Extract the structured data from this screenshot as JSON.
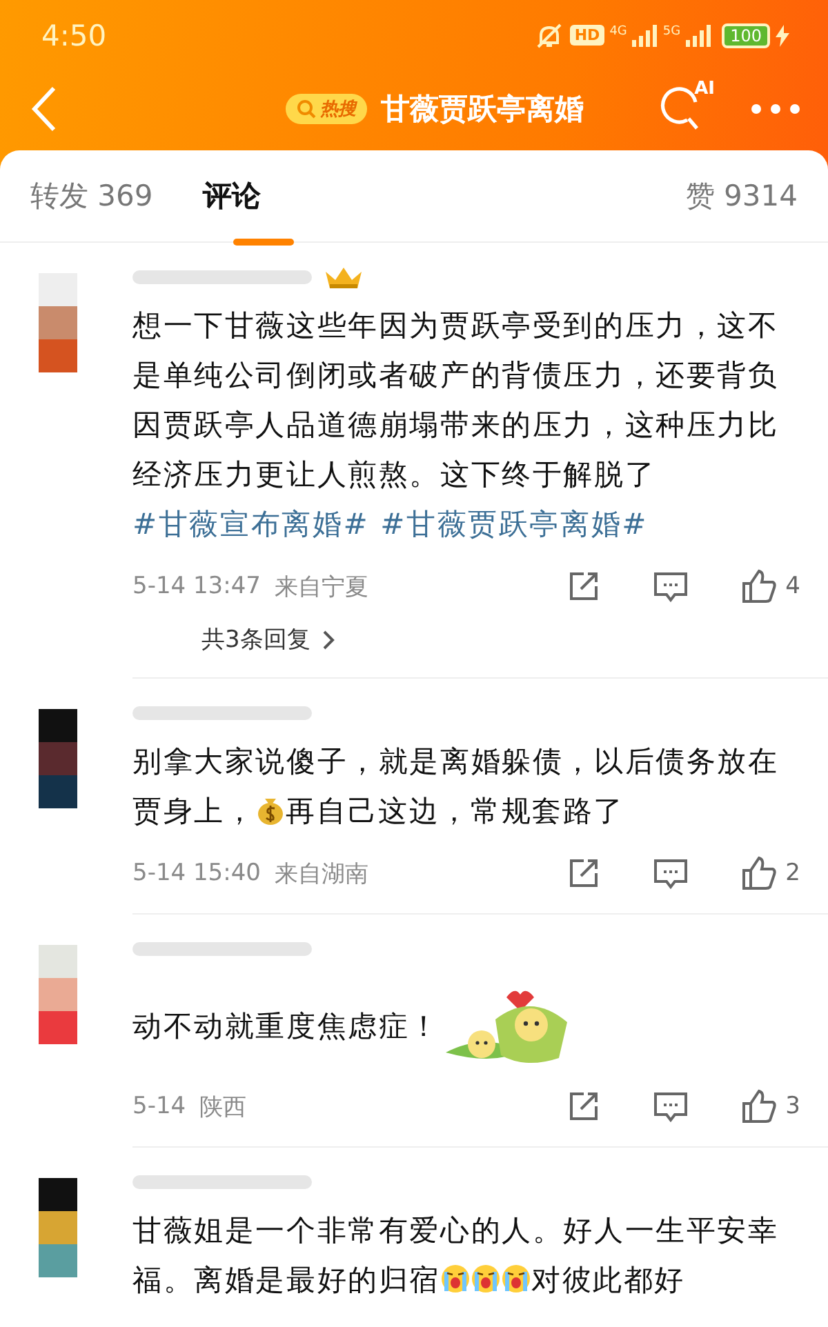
{
  "status_bar": {
    "time": "4:50",
    "hd": "HD",
    "network_a": "4G",
    "network_b": "5G",
    "battery": "100"
  },
  "header": {
    "badge": "热搜",
    "title": "甘薇贾跃亭离婚",
    "ai": "AI"
  },
  "tabs": [
    {
      "label": "转发 369",
      "selected": false
    },
    {
      "label": "评论",
      "selected": true
    }
  ],
  "likes_total": "赞 9314",
  "comments": [
    {
      "parts": [
        {
          "kind": "text",
          "text": "想一下甘薇这些年因为贾跃亭受到的压力，这不是单纯公司倒闭或者破产的背债压力，还要背负因贾跃亭人品道德崩塌带来的压力，这种压力比经济压力更让人煎熬。这下终于解脱了"
        },
        {
          "kind": "hashtag",
          "text": "#甘薇宣布离婚#"
        },
        {
          "kind": "space"
        },
        {
          "kind": "hashtag",
          "text": "#甘薇贾跃亭离婚#"
        }
      ],
      "crown": true,
      "date": "5-14 13:47",
      "location": "来自宁夏",
      "likes": "4",
      "replies": "共3条回复"
    },
    {
      "parts": [
        {
          "kind": "text",
          "text": "别拿大家说傻子，就是离婚躲债，以后债务放在贾身上，"
        },
        {
          "kind": "money-bag"
        },
        {
          "kind": "text",
          "text": "再自己这边，常规套路了"
        }
      ],
      "crown": false,
      "date": "5-14 15:40",
      "location": "来自湖南",
      "likes": "2"
    },
    {
      "parts": [
        {
          "kind": "text",
          "text": "动不动就重度焦虑症！"
        },
        {
          "kind": "sticker"
        }
      ],
      "crown": false,
      "date": "5-14",
      "location": "陕西",
      "likes": "3"
    },
    {
      "parts": [
        {
          "kind": "text",
          "text": "甘薇姐是一个非常有爱心的人。好人一生平安幸福。离婚是最好的归宿"
        },
        {
          "kind": "crying-face"
        },
        {
          "kind": "crying-face"
        },
        {
          "kind": "crying-face"
        },
        {
          "kind": "text",
          "text": "对彼此都好"
        }
      ],
      "crown": false
    }
  ]
}
